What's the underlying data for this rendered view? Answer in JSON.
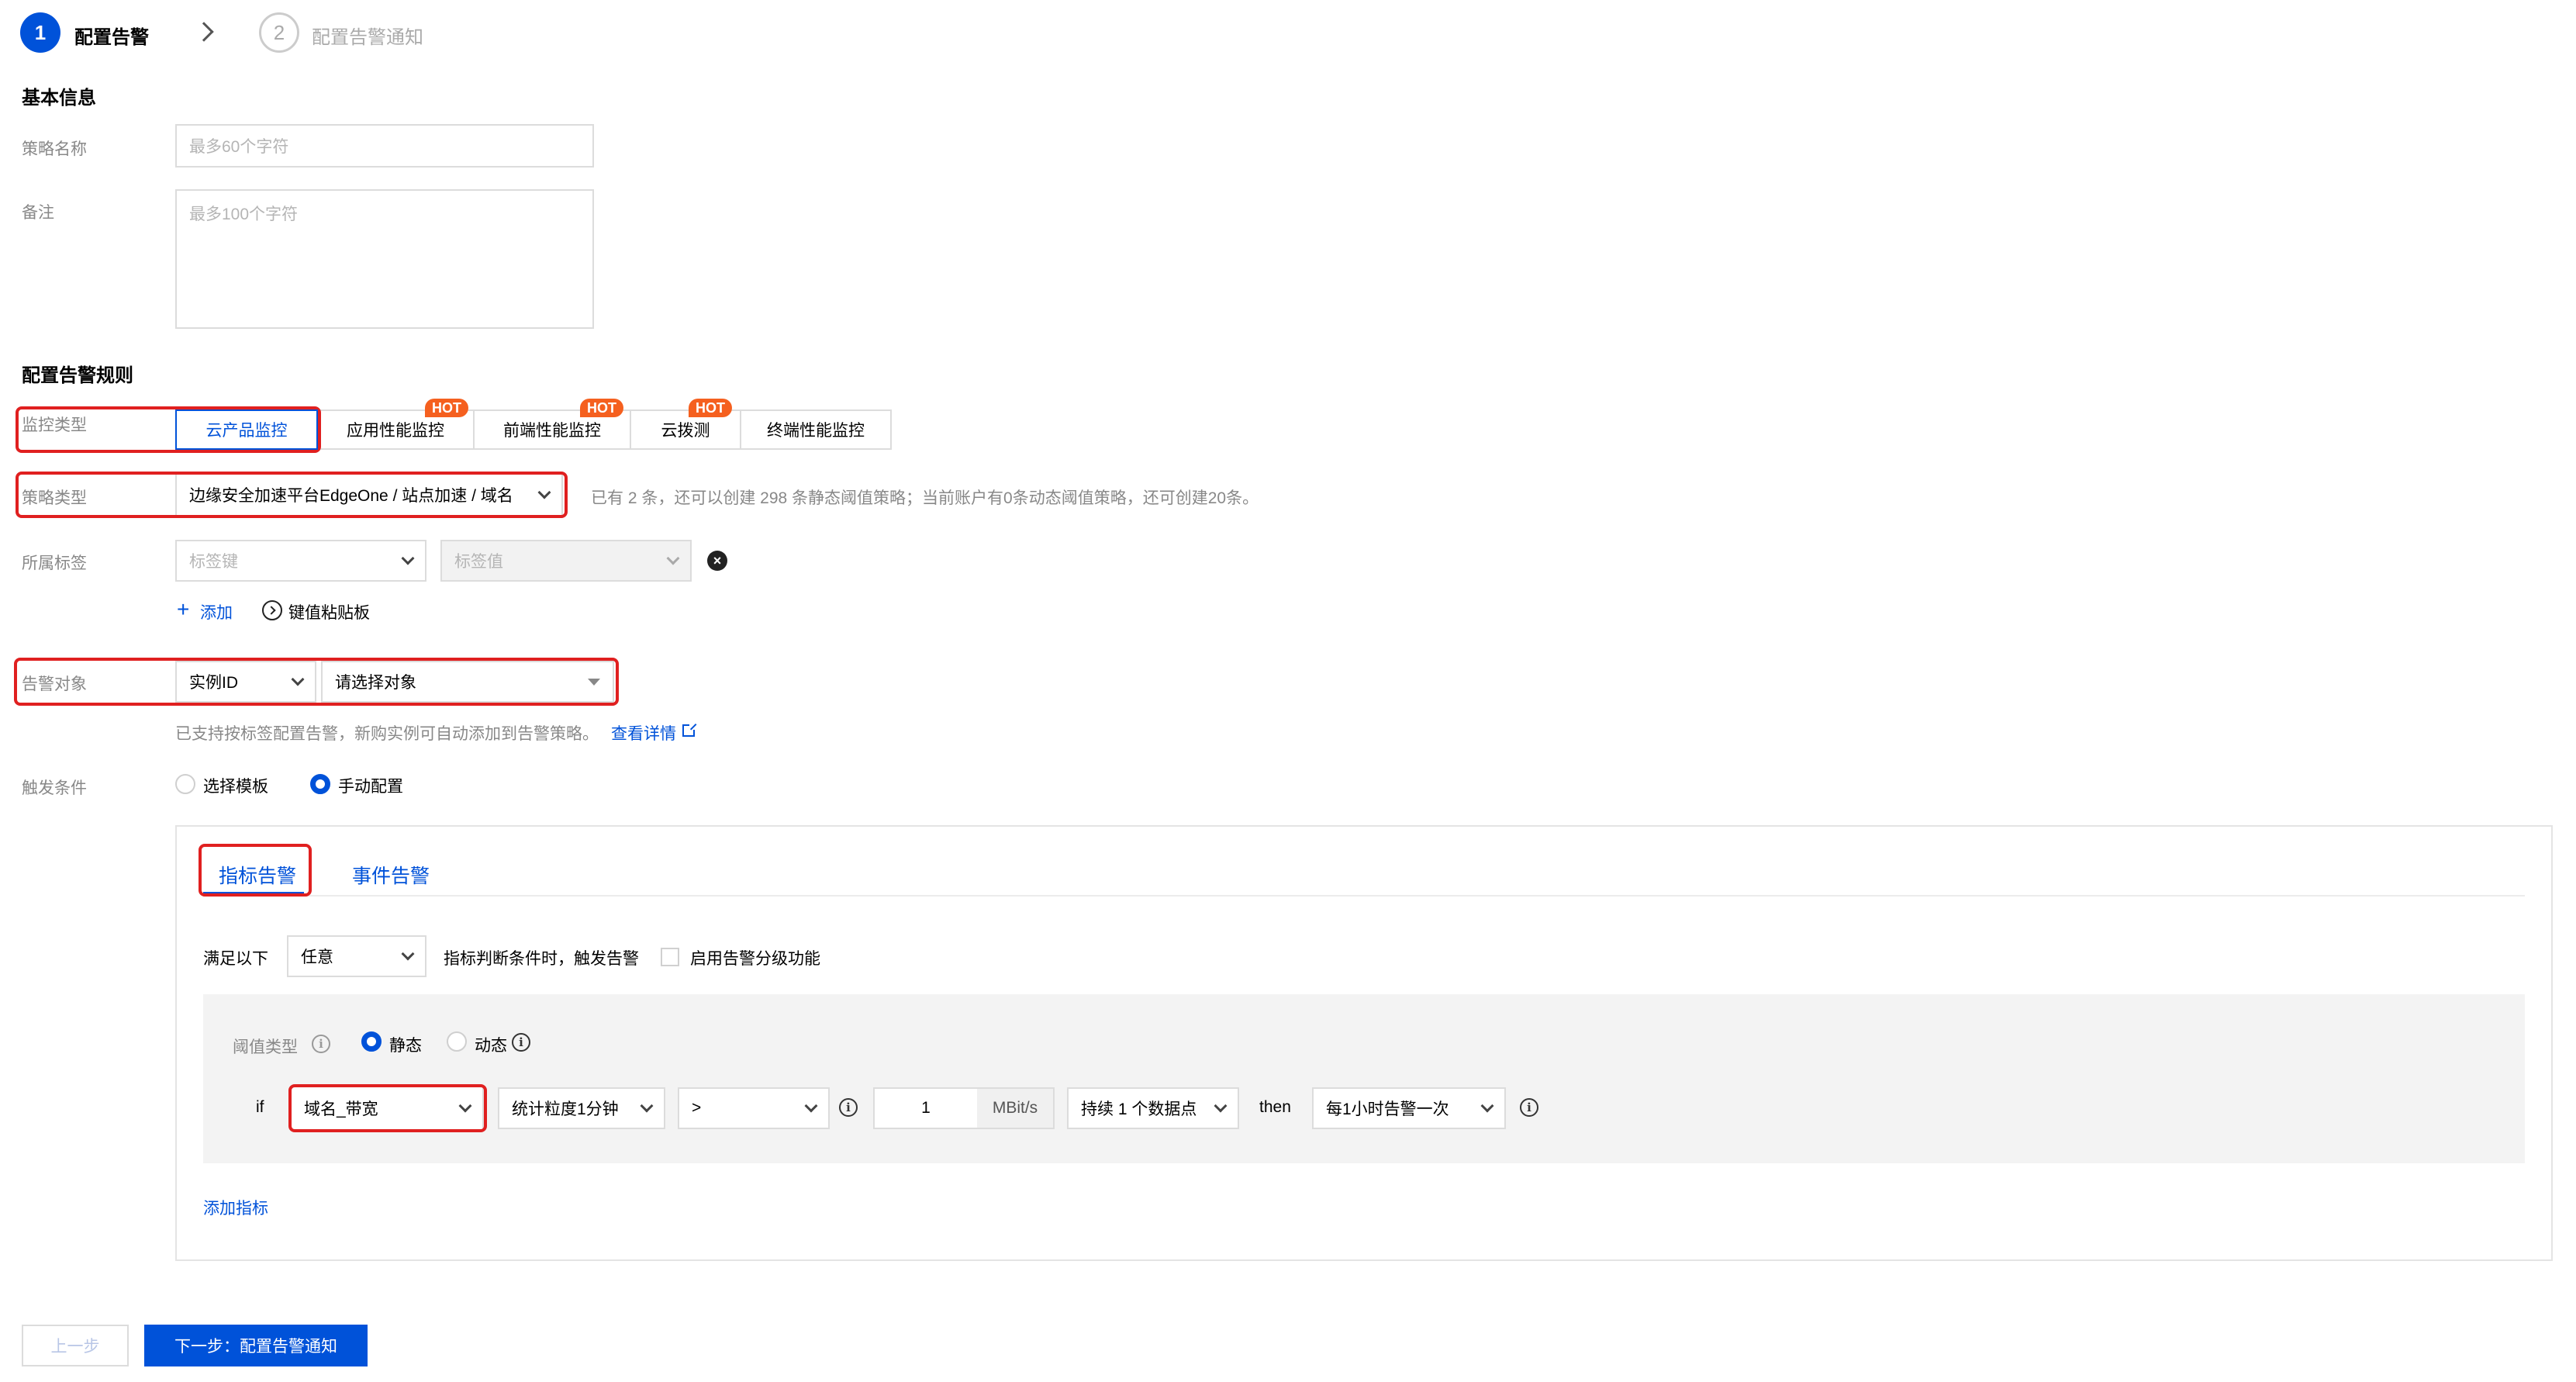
{
  "steps": [
    {
      "num": "1",
      "label": "配置告警"
    },
    {
      "num": "2",
      "label": "配置告警通知"
    }
  ],
  "basic": {
    "title": "基本信息",
    "name_label": "策略名称",
    "name_placeholder": "最多60个字符",
    "remark_label": "备注",
    "remark_placeholder": "最多100个字符"
  },
  "rules": {
    "title": "配置告警规则",
    "monitor_type_label": "监控类型",
    "monitor_types": [
      {
        "label": "云产品监控",
        "hot": ""
      },
      {
        "label": "应用性能监控",
        "hot": "HOT"
      },
      {
        "label": "前端性能监控",
        "hot": "HOT"
      },
      {
        "label": "云拨测",
        "hot": "HOT"
      },
      {
        "label": "终端性能监控",
        "hot": ""
      }
    ],
    "policy_type_label": "策略类型",
    "policy_type_value": "边缘安全加速平台EdgeOne / 站点加速 / 域名",
    "policy_type_hint": "已有 2 条，还可以创建 298 条静态阈值策略；当前账户有0条动态阈值策略，还可创建20条。",
    "tag_label": "所属标签",
    "tag_key_placeholder": "标签键",
    "tag_value_placeholder": "标签值",
    "add_label": "添加",
    "paste_label": "键值粘贴板",
    "target_label": "告警对象",
    "target_type_value": "实例ID",
    "target_select_placeholder": "请选择对象",
    "target_hint": "已支持按标签配置告警，新购实例可自动添加到告警策略。",
    "target_hint_link": "查看详情",
    "trigger_label": "触发条件",
    "trigger_options": [
      "选择模板",
      "手动配置"
    ]
  },
  "panel": {
    "tabs": [
      "指标告警",
      "事件告警"
    ],
    "cond_prefix": "满足以下",
    "cond_value": "任意",
    "cond_suffix": "指标判断条件时，触发告警",
    "grading_label": "启用告警分级功能",
    "threshold_label": "阈值类型",
    "threshold_options": [
      "静态",
      "动态"
    ],
    "if_label": "if",
    "metric_value": "域名_带宽",
    "granularity_value": "统计粒度1分钟",
    "operator_value": ">",
    "threshold_value": "1",
    "unit": "MBit/s",
    "duration_value": "持续 1 个数据点",
    "then_label": "then",
    "frequency_value": "每1小时告警一次",
    "add_metric_label": "添加指标"
  },
  "footer": {
    "prev_label": "上一步",
    "next_label": "下一步：配置告警通知"
  },
  "colors": {
    "primary": "#0052d9",
    "highlight": "#e02020",
    "hot": "#f5601f"
  }
}
